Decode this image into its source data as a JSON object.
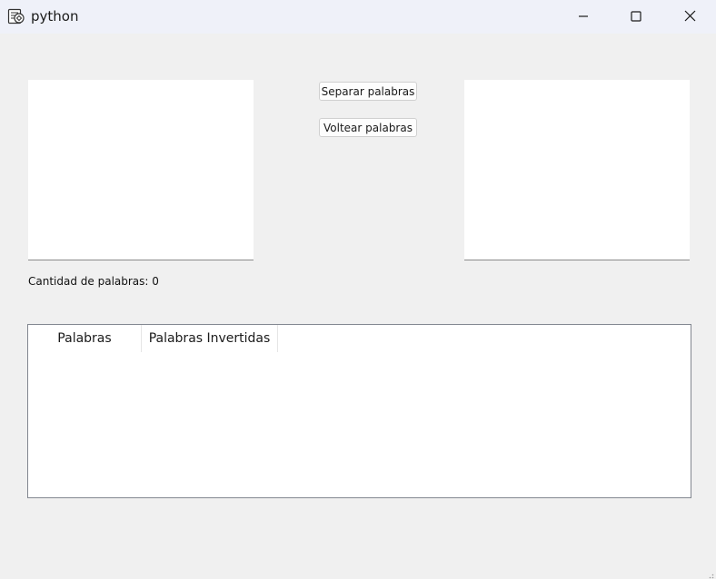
{
  "window": {
    "title": "python",
    "icons": {
      "app": "python-feather-icon",
      "minimize": "minimize-icon",
      "maximize": "maximize-icon",
      "close": "close-icon"
    }
  },
  "buttons": {
    "separar_label": "Separar palabras",
    "voltear_label": "Voltear palabras"
  },
  "inputs": {
    "left_value": "",
    "right_value": ""
  },
  "status": {
    "count_label": "Cantidad de palabras: 0"
  },
  "table": {
    "columns": [
      "Palabras",
      "Palabras Invertidas"
    ],
    "rows": []
  },
  "colors": {
    "window_bg": "#f0f0f0",
    "titlebar_bg": "#eff1f9",
    "field_bg": "#ffffff"
  }
}
